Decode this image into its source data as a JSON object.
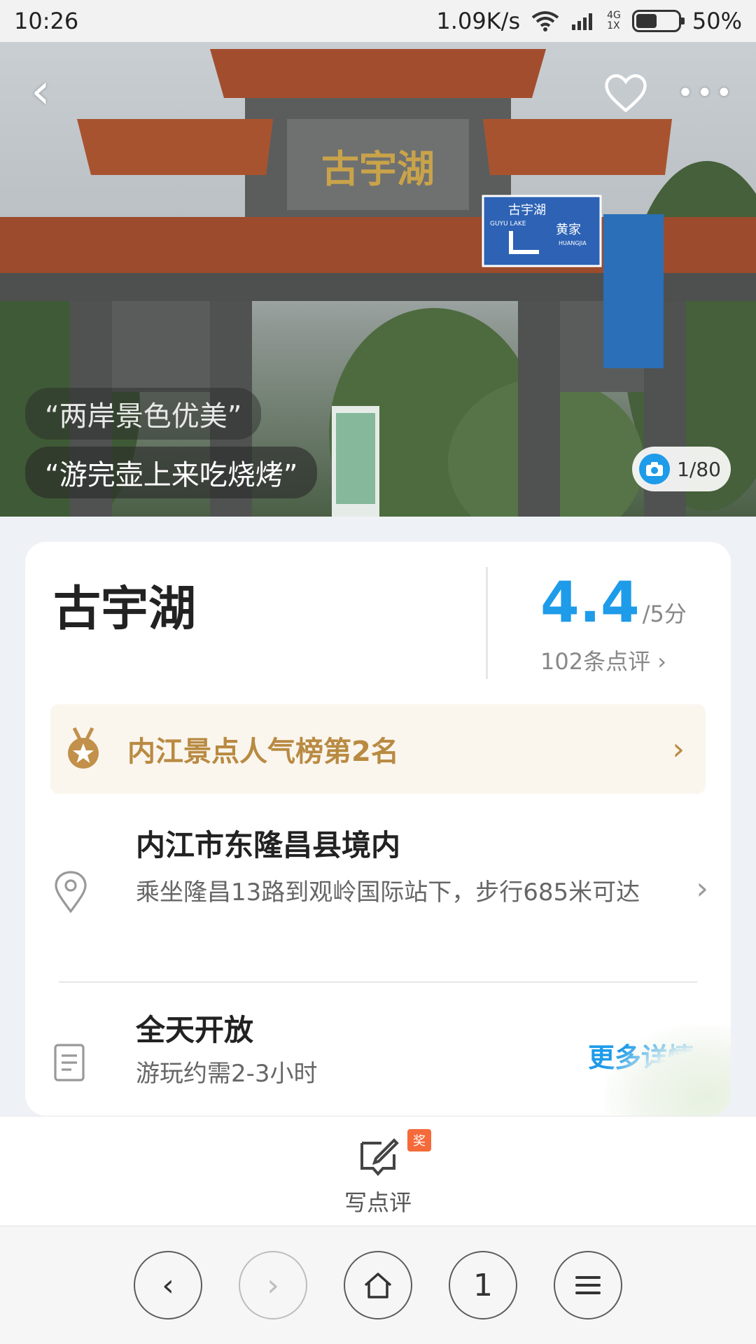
{
  "status_bar": {
    "time": "10:26",
    "net_speed": "1.09K/s",
    "network_top": "4G",
    "network_bottom": "1X",
    "battery": "50%",
    "battery_level": 0.5
  },
  "hero": {
    "quotes": [
      "“两岸景色优美”",
      "“游完壶上来吃烧烤”"
    ],
    "photo_count": "1/80",
    "gate_sign": "古宇湖",
    "road_sign": {
      "title": "古宇湖",
      "sub": "GUYU LAKE",
      "dest": "黄家",
      "dest_sub": "HUANGJIA"
    },
    "icons": {
      "back": "back-arrow-icon",
      "favorite": "heart-icon",
      "more": "more-icon",
      "camera": "camera-icon"
    }
  },
  "poi": {
    "name": "古宇湖",
    "score": "4.4",
    "score_scale": "/5分",
    "review_count": "102条点评 ›",
    "rank": "内江景点人气榜第2名",
    "address_title": "内江市东隆昌县境内",
    "address_sub": "乘坐隆昌13路到观岭国际站下，步行685米可达",
    "hours_title": "全天开放",
    "hours_sub": "游玩约需2-3小时",
    "more_details": "更多详情"
  },
  "review_bar": {
    "label": "写点评",
    "badge": "奖"
  },
  "browser_nav": {
    "tabs_count": "1"
  },
  "colors": {
    "accent": "#1e9be9",
    "rank_gold": "#b98a42",
    "badge": "#f56a3a"
  }
}
